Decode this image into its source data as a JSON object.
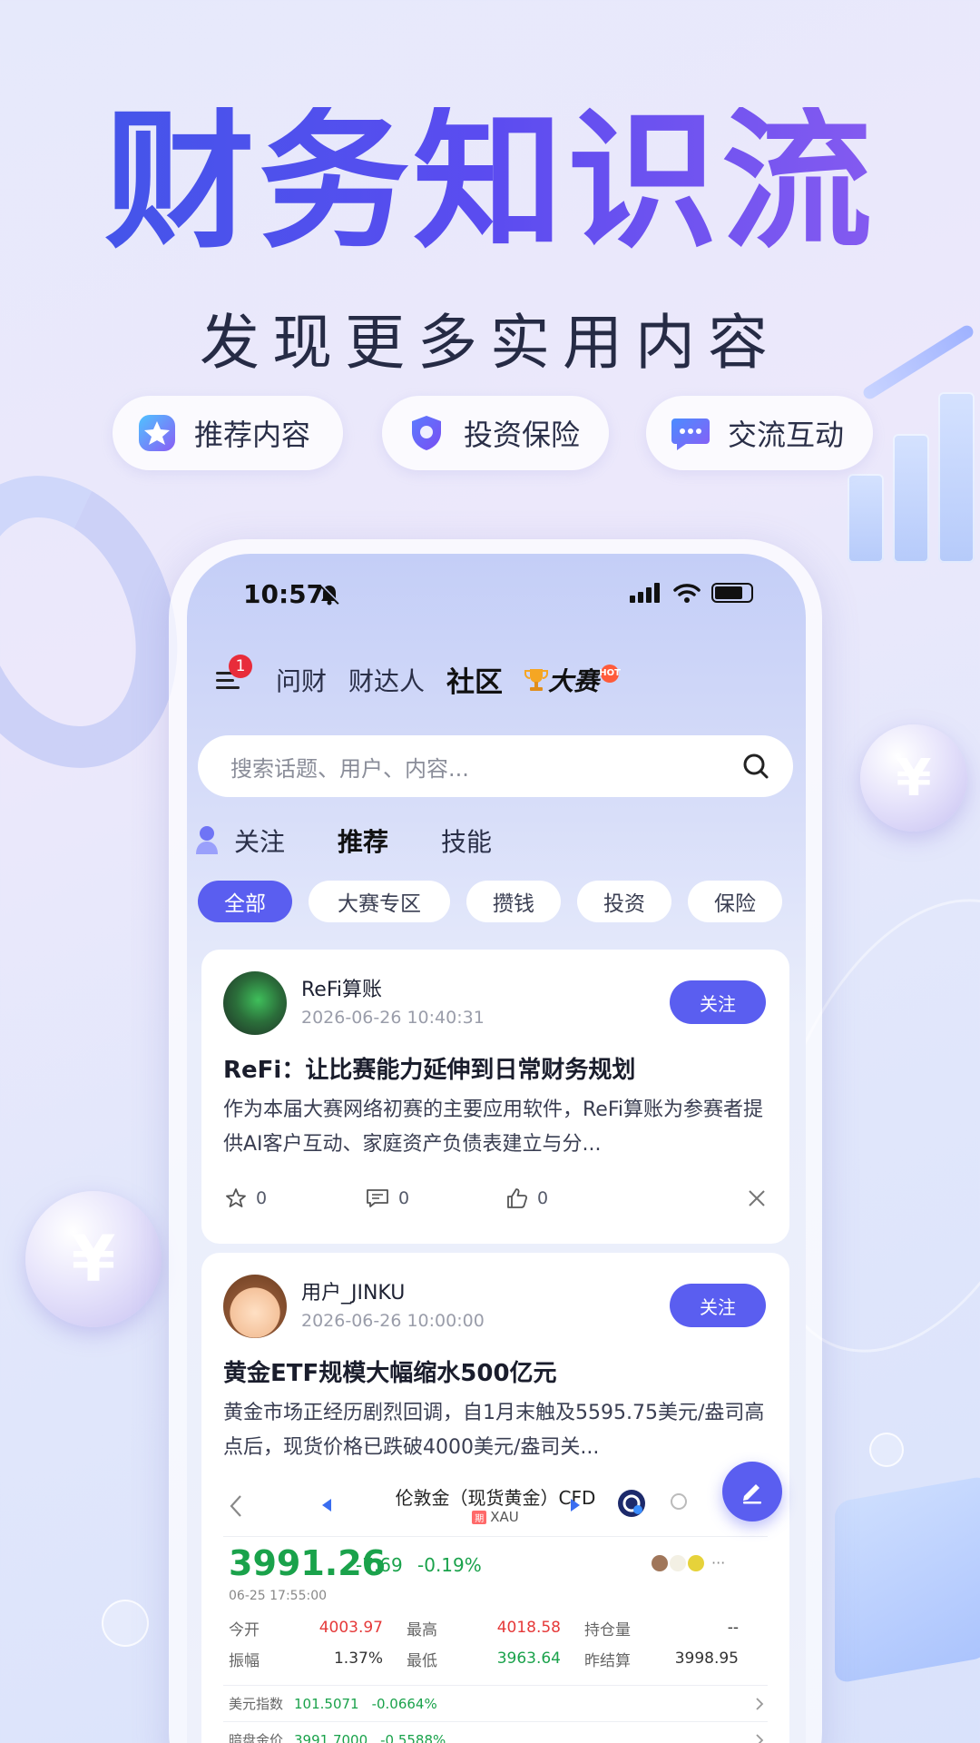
{
  "promo": {
    "headline": "财务知识流",
    "subline": "发现更多实用内容",
    "pills": [
      {
        "label": "推荐内容",
        "icon": "star-icon"
      },
      {
        "label": "投资保险",
        "icon": "shield-icon"
      },
      {
        "label": "交流互动",
        "icon": "chat-bubble-icon"
      }
    ]
  },
  "status_bar": {
    "time": "10:57"
  },
  "nav": {
    "menu_badge": "1",
    "items": [
      "问财",
      "财达人",
      "社区"
    ],
    "contest": "大赛",
    "hot_badge": "HOT"
  },
  "search": {
    "placeholder": "搜索话题、用户、内容..."
  },
  "subtabs": [
    "关注",
    "推荐",
    "技能"
  ],
  "chips": [
    "全部",
    "大赛专区",
    "攒钱",
    "投资",
    "保险"
  ],
  "posts": [
    {
      "user": "ReFi算账",
      "time": "2026-06-26 10:40:31",
      "follow": "关注",
      "title": "ReFi：让比赛能力延伸到日常财务规划",
      "body": "作为本届大赛网络初赛的主要应用软件，ReFi算账为参赛者提供AI客户互动、家庭资产负债表建立与分...",
      "stars": "0",
      "comments": "0",
      "likes": "0"
    },
    {
      "user": "用户_JINKU",
      "time": "2026-06-26 10:00:00",
      "follow": "关注",
      "title": "黄金ETF规模大幅缩水500亿元",
      "body": "黄金市场正经历剧烈回调，自1月末触及5595.75美元/盎司高点后，现货价格已跌破4000美元/盎司关..."
    }
  ],
  "quote": {
    "name": "伦敦金（现货黄金）CFD",
    "tag": "期",
    "code": "XAU",
    "price": "3991.26",
    "change": "-7.69",
    "change_pct": "-0.19%",
    "date": "06-25 17:55:00",
    "rows": [
      [
        {
          "label": "今开",
          "value": "4003.97"
        },
        {
          "label": "最高",
          "value": "4018.58"
        },
        {
          "label": "持仓量",
          "value": "--"
        }
      ],
      [
        {
          "label": "振幅",
          "value": "1.37%"
        },
        {
          "label": "最低",
          "value": "3963.64"
        },
        {
          "label": "昨结算",
          "value": "3998.95"
        }
      ]
    ],
    "related": [
      {
        "name": "美元指数",
        "value": "101.5071",
        "pct": "-0.0664%"
      },
      {
        "name": "暗盘金价",
        "value": "3991.7000",
        "pct": "-0.5588%"
      }
    ],
    "more": "···"
  },
  "colors": {
    "accent": "#5a5ef0",
    "up": "#e53939",
    "down": "#1aa24b"
  }
}
